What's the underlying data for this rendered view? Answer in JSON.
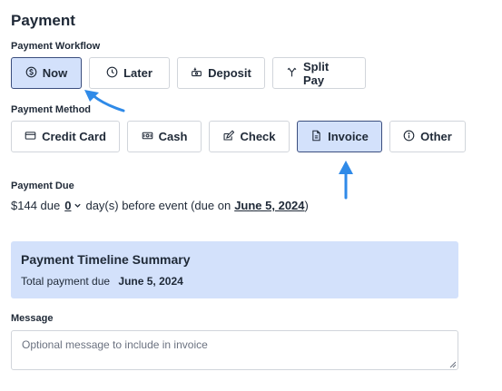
{
  "page": {
    "title": "Payment"
  },
  "workflow": {
    "label": "Payment Workflow",
    "options": [
      {
        "label": "Now",
        "icon": "dollar-circle-icon",
        "selected": true
      },
      {
        "label": "Later",
        "icon": "clock-icon",
        "selected": false
      },
      {
        "label": "Deposit",
        "icon": "deposit-icon",
        "selected": false
      },
      {
        "label": "Split Pay",
        "icon": "split-icon",
        "selected": false
      }
    ]
  },
  "method": {
    "label": "Payment Method",
    "options": [
      {
        "label": "Credit Card",
        "icon": "credit-card-icon",
        "selected": false
      },
      {
        "label": "Cash",
        "icon": "cash-icon",
        "selected": false
      },
      {
        "label": "Check",
        "icon": "check-icon",
        "selected": false
      },
      {
        "label": "Invoice",
        "icon": "invoice-icon",
        "selected": true
      },
      {
        "label": "Other",
        "icon": "info-icon",
        "selected": false
      }
    ]
  },
  "due": {
    "label": "Payment Due",
    "amount_text": "$144 due",
    "days_value": "0",
    "middle_text": "day(s) before event (due on",
    "due_date": "June 5, 2024",
    "close_text": ")"
  },
  "summary": {
    "title": "Payment Timeline Summary",
    "total_label": "Total payment due",
    "total_date": "June 5, 2024"
  },
  "message": {
    "label": "Message",
    "placeholder": "Optional message to include in invoice"
  },
  "colors": {
    "selected_bg": "#d3e1fb",
    "accent_arrow": "#2f8ae8",
    "border": "#d1d5db"
  }
}
